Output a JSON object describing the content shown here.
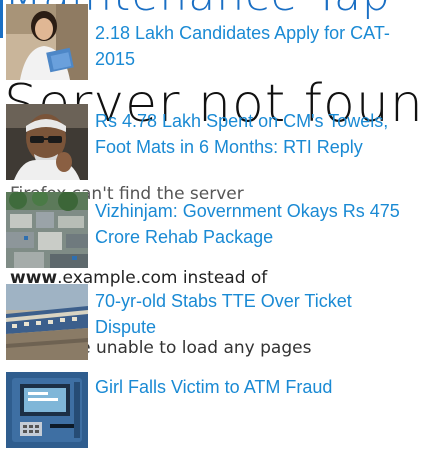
{
  "background_page": {
    "heading_top": "Maintenance Tap",
    "heading_main": "Server not found",
    "line_1": "Firefox can't find the server",
    "line_2_prefix": "www",
    "line_2_rest": ".example.com instead of",
    "line_3": "If you are unable to load any pages"
  },
  "news": {
    "items": [
      {
        "headline": "2.18 Lakh Candidates Apply for CAT-2015",
        "thumb_icon": "student-photo-icon"
      },
      {
        "headline": "Rs 4.78 Lakh Spent on CM's Towels, Foot Mats in 6 Months: RTI Reply",
        "thumb_icon": "politician-photo-icon"
      },
      {
        "headline": "Vizhinjam: Government Okays Rs 475 Crore Rehab Package",
        "thumb_icon": "coastal-village-photo-icon"
      },
      {
        "headline": "70-yr-old Stabs TTE Over Ticket Dispute",
        "thumb_icon": "train-photo-icon"
      },
      {
        "headline": "Girl Falls Victim to ATM Fraud",
        "thumb_icon": "atm-photo-icon"
      }
    ]
  },
  "colors": {
    "link": "#1a8ad4",
    "bg_heading_accent": "#1a6fc4"
  }
}
